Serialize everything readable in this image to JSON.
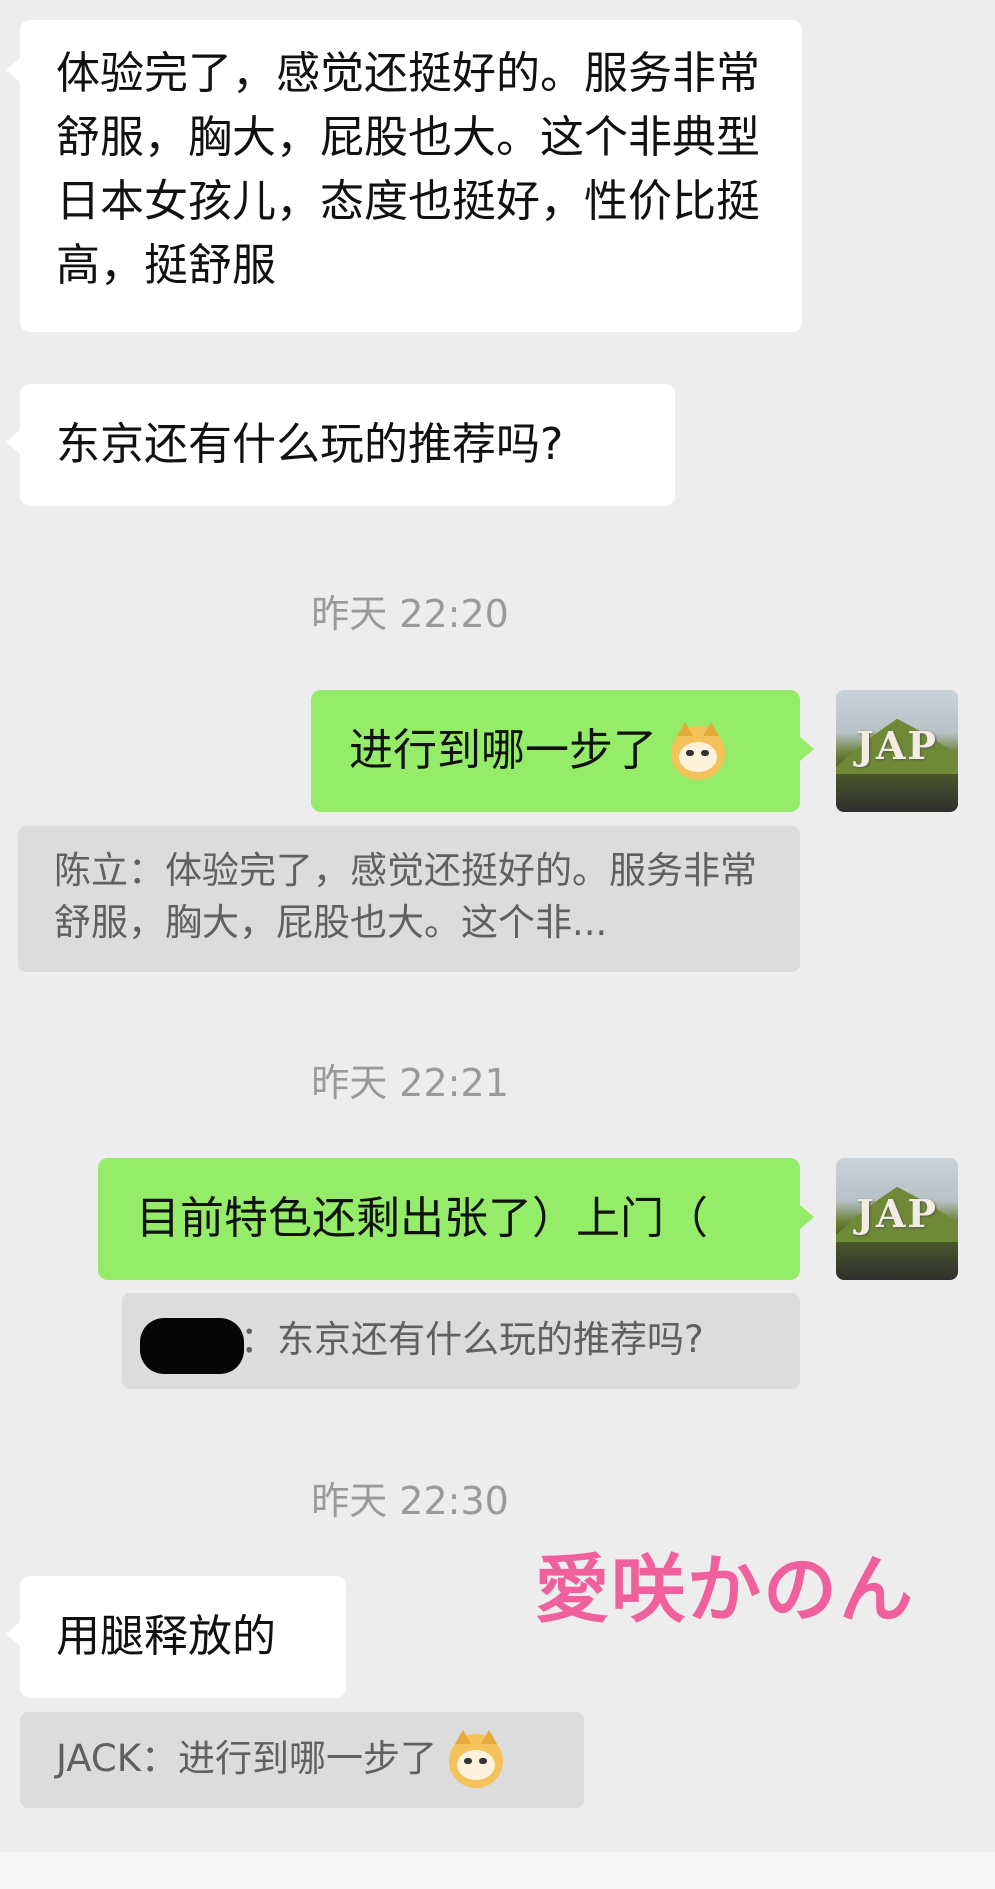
{
  "messages": {
    "m1": "体验完了，感觉还挺好的。服务非常舒服，胸大，屁股也大。这个非典型日本女孩儿，态度也挺好，性价比挺高，挺舒服",
    "m2": "东京还有什么玩的推荐吗?",
    "m3": "进行到哪一步了",
    "m4": "目前特色还剩出张了）上门（",
    "m5": "用腿释放的"
  },
  "quotes": {
    "q1": "陈立：体验完了，感觉还挺好的。服务非常舒服，胸大，屁股也大。这个非...",
    "q2": "：东京还有什么玩的推荐吗?",
    "q3": "JACK：进行到哪一步了"
  },
  "timestamps": {
    "t1": "昨天 22:20",
    "t2": "昨天 22:21",
    "t3": "昨天 22:30"
  },
  "avatar_text": "JAP",
  "emoji_icon": "doge-emoji",
  "watermark": "愛咲かのん",
  "colors": {
    "background": "#ededed",
    "incoming_bubble": "#ffffff",
    "outgoing_bubble": "#95ec69",
    "quote_bg": "#dcdcdc",
    "watermark": "#f0609c"
  }
}
